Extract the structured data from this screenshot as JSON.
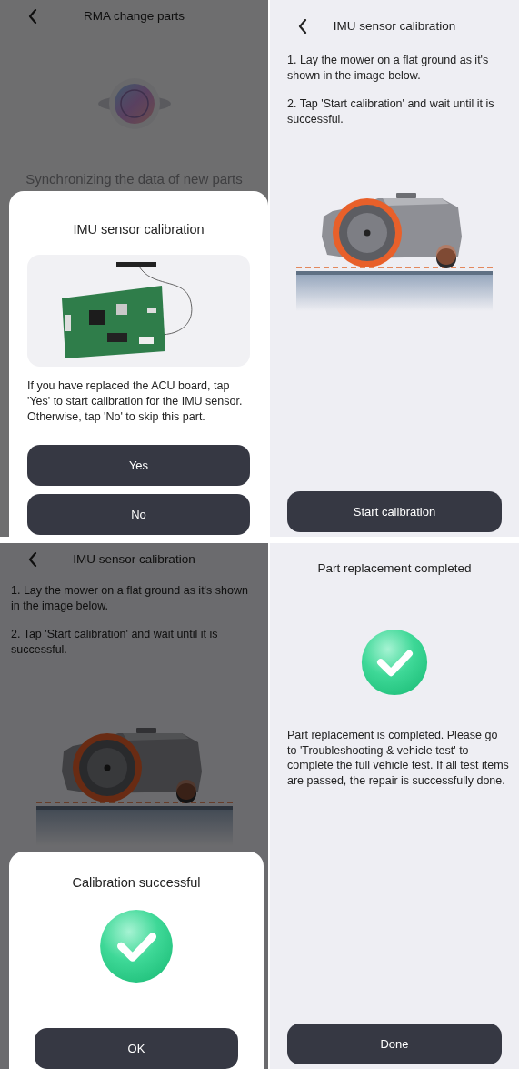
{
  "screens": [
    {
      "kind": "sync",
      "dimmed": true,
      "back": true,
      "title": "RMA change parts",
      "status": "Synchronizing the data of new parts",
      "dialog": {
        "kind": "image",
        "title": "IMU sensor calibration",
        "message": "If you have replaced the ACU board, tap 'Yes' to start calibration for the IMU sensor. Otherwise, tap 'No' to skip this part.",
        "buttons": [
          "Yes",
          "No"
        ]
      }
    },
    {
      "kind": "steps",
      "dimmed": false,
      "back": true,
      "title": "IMU sensor calibration",
      "steps": [
        "1. Lay the mower on a flat ground as it's shown in the image below.",
        "2. Tap 'Start calibration' and wait until it is successful."
      ],
      "button": "Start calibration"
    },
    {
      "kind": "steps",
      "dimmed": true,
      "back": true,
      "title": "IMU sensor calibration",
      "steps": [
        "1. Lay the mower on a flat ground as it's shown in the image below.",
        "2. Tap 'Start calibration' and wait until it is successful."
      ],
      "dialog": {
        "kind": "success",
        "title": "Calibration successful",
        "buttons": [
          "OK"
        ]
      }
    },
    {
      "kind": "result",
      "dimmed": false,
      "back": false,
      "title": "Part replacement completed",
      "message": "Part replacement is completed. Please go to 'Troubleshooting & vehicle test' to complete the full vehicle test. If all test items are passed, the repair is successfully done.",
      "button": "Done"
    }
  ]
}
